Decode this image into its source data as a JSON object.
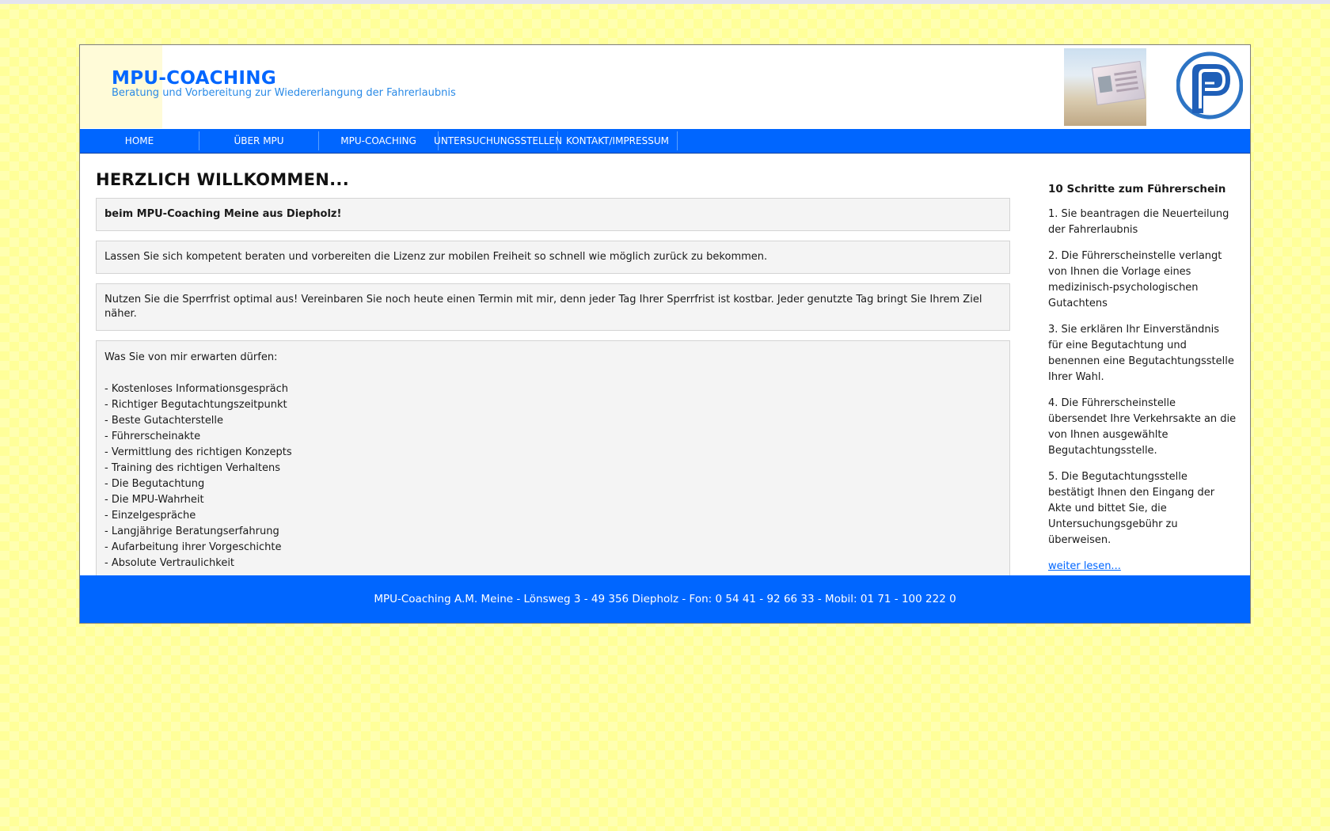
{
  "header": {
    "title": "MPU-COACHING",
    "subtitle": "Beratung und Vorbereitung zur Wiedererlangung der Fahrerlaubnis"
  },
  "nav": {
    "items": [
      {
        "label": "HOME"
      },
      {
        "label": "ÜBER MPU"
      },
      {
        "label": "MPU-COACHING"
      },
      {
        "label": "UNTERSUCHUNGSSTELLEN"
      },
      {
        "label": "KONTAKT/IMPRESSUM"
      }
    ]
  },
  "main": {
    "heading": "HERZLICH WILLKOMMEN...",
    "welcome": "beim MPU-Coaching Meine aus Diepholz!",
    "paragraph1": "Lassen Sie sich kompetent beraten und vorbereiten die Lizenz zur mobilen Freiheit so schnell wie möglich zurück zu bekommen.",
    "paragraph2": "Nutzen Sie die Sperrfrist optimal aus! Vereinbaren Sie noch heute einen Termin mit mir, denn jeder Tag Ihrer Sperrfrist ist kostbar. Jeder genutzte Tag bringt Sie Ihrem Ziel näher.",
    "list_intro": "Was Sie von mir erwarten dürfen:",
    "list_items": [
      "- Kostenloses Informationsgespräch",
      "- Richtiger Begutachtungszeitpunkt",
      "- Beste Gutachterstelle",
      "- Führerscheinakte",
      "- Vermittlung des richtigen Konzepts",
      "- Training des richtigen Verhaltens",
      "- Die Begutachtung",
      "- Die MPU-Wahrheit",
      "- Einzelgespräche",
      "- Langjährige Beratungserfahrung",
      "- Aufarbeitung ihrer Vorgeschichte",
      "- Absolute Vertraulichkeit"
    ]
  },
  "sidebar": {
    "heading": "10 Schritte zum Führerschein",
    "steps": [
      "1. Sie beantragen die Neuerteilung der Fahrerlaubnis",
      "2. Die Führerscheinstelle verlangt von Ihnen die Vorlage eines medizinisch-psychologischen Gutachtens",
      "3. Sie erklären Ihr Einverständnis für eine Begutachtung und benennen eine Begutachtungsstelle Ihrer Wahl.",
      "4. Die Führerscheinstelle übersendet Ihre Verkehrsakte an die von Ihnen ausgewählte Begutachtungsstelle.",
      "5. Die Begutachtungsstelle bestätigt Ihnen den Eingang der Akte und bittet Sie, die Untersuchungsgebühr zu überweisen."
    ],
    "read_more": "weiter lesen..."
  },
  "footer": {
    "text": "MPU-Coaching A.M. Meine - Lönsweg 3 - 49 356 Diepholz - Fon: 0 54 41 - 92 66 33 - Mobil: 01 71 - 100 222 0"
  },
  "colors": {
    "accent": "#0066ff",
    "background": "#ffffb0",
    "box": "#f4f4f4"
  },
  "icons": {
    "header_photo": "driving-license-photo",
    "logo": "mpu-logo"
  }
}
